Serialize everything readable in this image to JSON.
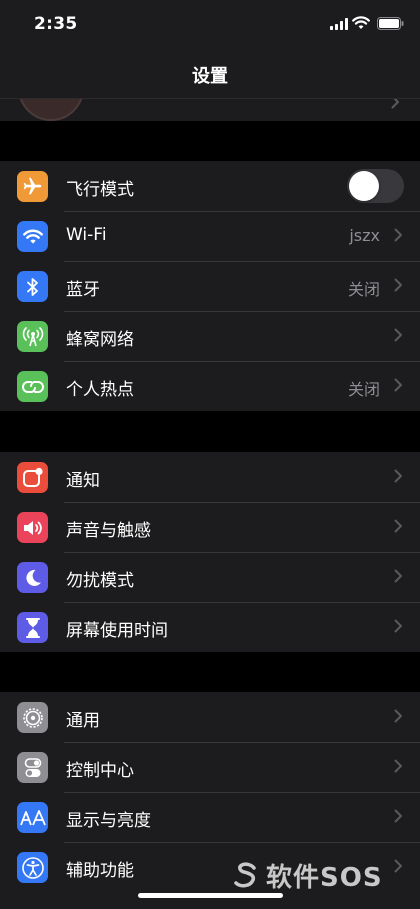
{
  "status_bar": {
    "time": "2:35"
  },
  "nav": {
    "title": "设置"
  },
  "groups": [
    {
      "items": [
        {
          "label": "飞行模式",
          "icon": "airplane-icon",
          "color": "#f09a37",
          "toggle": false
        },
        {
          "label": "Wi-Fi",
          "icon": "wifi-icon",
          "color": "#3478f6",
          "value": "jszx"
        },
        {
          "label": "蓝牙",
          "icon": "bluetooth-icon",
          "color": "#3478f6",
          "value": "关闭"
        },
        {
          "label": "蜂窝网络",
          "icon": "antenna-icon",
          "color": "#5ac05a",
          "value": ""
        },
        {
          "label": "个人热点",
          "icon": "hotspot-icon",
          "color": "#5ac05a",
          "value": "关闭"
        }
      ]
    },
    {
      "items": [
        {
          "label": "通知",
          "icon": "notification-icon",
          "color": "#eb4d3d"
        },
        {
          "label": "声音与触感",
          "icon": "speaker-icon",
          "color": "#eb445a"
        },
        {
          "label": "勿扰模式",
          "icon": "moon-icon",
          "color": "#5e5ce6"
        },
        {
          "label": "屏幕使用时间",
          "icon": "hourglass-icon",
          "color": "#5e5ce6"
        }
      ]
    },
    {
      "items": [
        {
          "label": "通用",
          "icon": "gear-icon",
          "color": "#8e8e93"
        },
        {
          "label": "控制中心",
          "icon": "switches-icon",
          "color": "#8e8e93"
        },
        {
          "label": "显示与亮度",
          "icon": "text-size-icon",
          "color": "#3478f6"
        },
        {
          "label": "辅助功能",
          "icon": "accessibility-icon",
          "color": "#3478f6"
        }
      ]
    }
  ],
  "watermark": {
    "text": "软件SOS"
  }
}
